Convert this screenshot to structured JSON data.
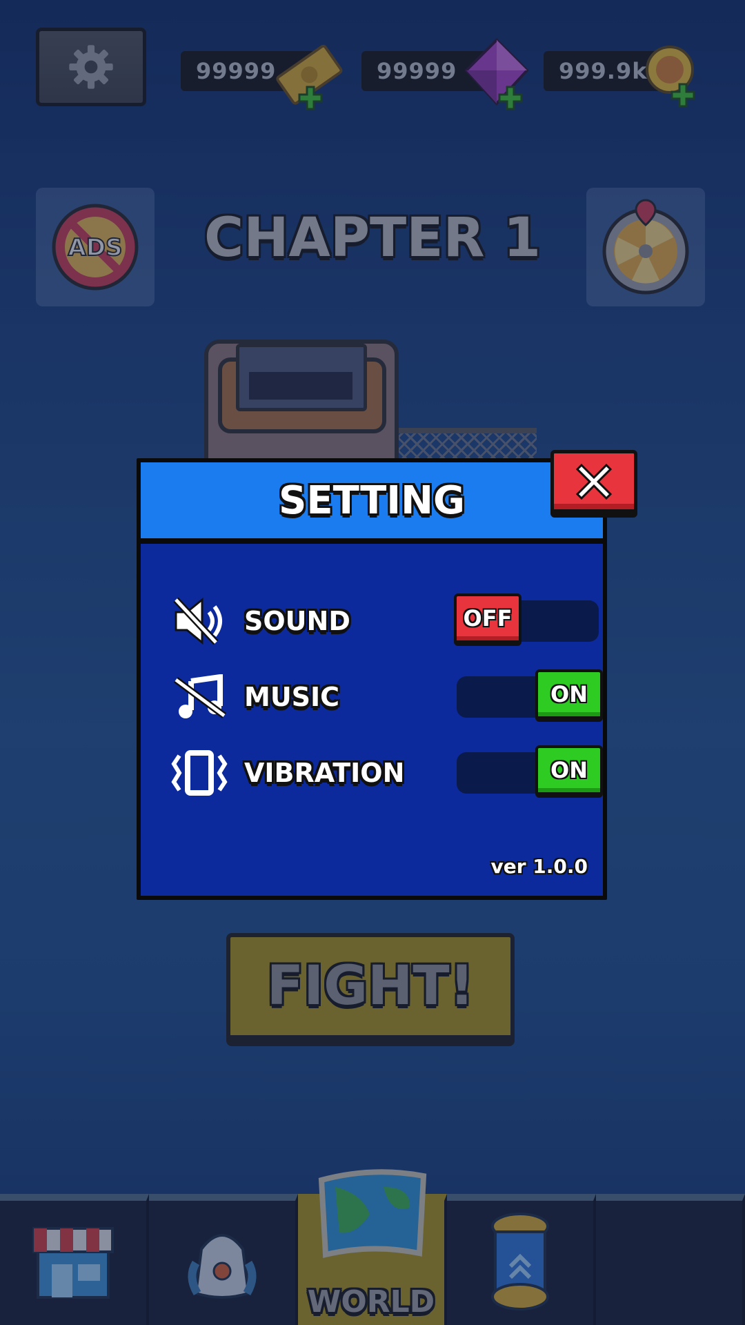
{
  "topbar": {
    "tickets": "99999",
    "gems": "99999",
    "coins": "999.9k"
  },
  "chapter": {
    "title": "CHAPTER 1",
    "ads_label": "ADS"
  },
  "fight": {
    "label": "FIGHT!"
  },
  "bottom_nav": {
    "items": [
      {
        "id": "shop",
        "label": "",
        "icon": "shop-icon"
      },
      {
        "id": "backpack",
        "label": "",
        "icon": "backpack-icon"
      },
      {
        "id": "world",
        "label": "WORLD",
        "icon": "map-icon",
        "active": true
      },
      {
        "id": "upgrade",
        "label": "",
        "icon": "capsule-icon"
      },
      {
        "id": "empty",
        "label": ""
      }
    ]
  },
  "settings": {
    "title": "SETTING",
    "rows": [
      {
        "label": "SOUND",
        "state": "OFF",
        "icon": "sound-muted-icon"
      },
      {
        "label": "MUSIC",
        "state": "ON",
        "icon": "music-muted-icon"
      },
      {
        "label": "VIBRATION",
        "state": "ON",
        "icon": "vibration-icon"
      }
    ],
    "version": "ver 1.0.0"
  },
  "colors": {
    "header_blue": "#1b7cf0",
    "panel_blue": "#0d2a9c",
    "off_red": "#e8343c",
    "on_green": "#2ecc23",
    "fight_yellow": "#a88f14"
  }
}
